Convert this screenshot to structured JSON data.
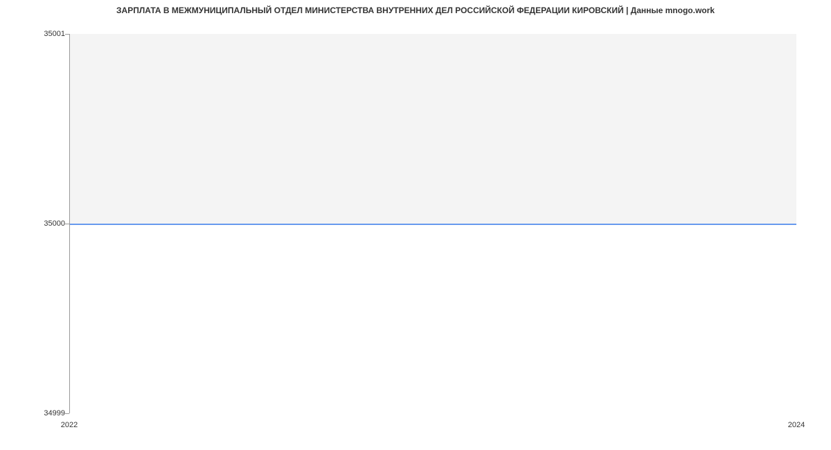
{
  "chart_data": {
    "type": "line",
    "title": "ЗАРПЛАТА В МЕЖМУНИЦИПАЛЬНЫЙ ОТДЕЛ МИНИСТЕРСТВА ВНУТРЕННИХ ДЕЛ РОССИЙСКОЙ ФЕДЕРАЦИИ КИРОВСКИЙ | Данные mnogo.work",
    "x": [
      2022,
      2024
    ],
    "values": [
      35000,
      35000
    ],
    "xlabel": "",
    "ylabel": "",
    "xlim": [
      2022,
      2024
    ],
    "ylim": [
      34999,
      35001
    ],
    "x_ticks": [
      "2022",
      "2024"
    ],
    "y_ticks": [
      "34999",
      "35000",
      "35001"
    ],
    "series_color": "#6699ee"
  }
}
